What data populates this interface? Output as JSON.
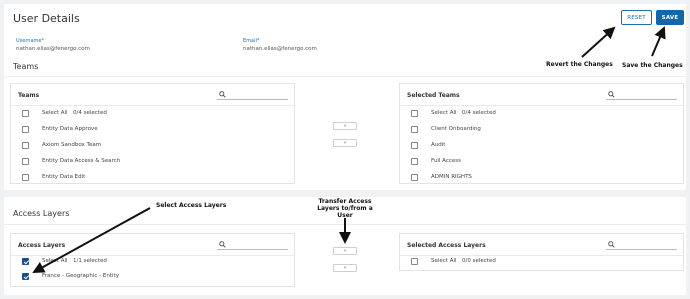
{
  "header": {
    "title": "User Details",
    "reset_label": "RESET",
    "save_label": "SAVE"
  },
  "user": {
    "username_label": "Username*",
    "username_value": "nathan.elias@fenergo.com",
    "email_label": "Email*",
    "email_value": "nathan.elias@fenergo.com"
  },
  "teams": {
    "section_title": "Teams",
    "available": {
      "title": "Teams",
      "select_all": "Select All",
      "count": "0/4 selected",
      "items": [
        "Entity Data Approve",
        "Axiom Sandbox Team",
        "Entity Data Access & Search",
        "Entity Data Edit"
      ]
    },
    "selected": {
      "title": "Selected Teams",
      "select_all": "Select All",
      "count": "0/4 selected",
      "items": [
        "Client Onboarding",
        "Audit",
        "Full Access",
        "ADMIN RIGHTS"
      ]
    },
    "move_right": "»",
    "move_left": "«"
  },
  "access_layers": {
    "section_title": "Access Layers",
    "available": {
      "title": "Access Layers",
      "select_all": "Select All",
      "count": "1/1 selected",
      "items": [
        "France - Geographic - Entity"
      ]
    },
    "selected": {
      "title": "Selected Access Layers",
      "select_all": "Select All",
      "count": "0/0 selected"
    },
    "move_right": "»",
    "move_left": "«"
  },
  "annotations": {
    "revert": "Revert the Changes",
    "save": "Save the Changes",
    "select_layers": "Select Access Layers",
    "transfer": "Transfer Access Layers to/from a User"
  }
}
